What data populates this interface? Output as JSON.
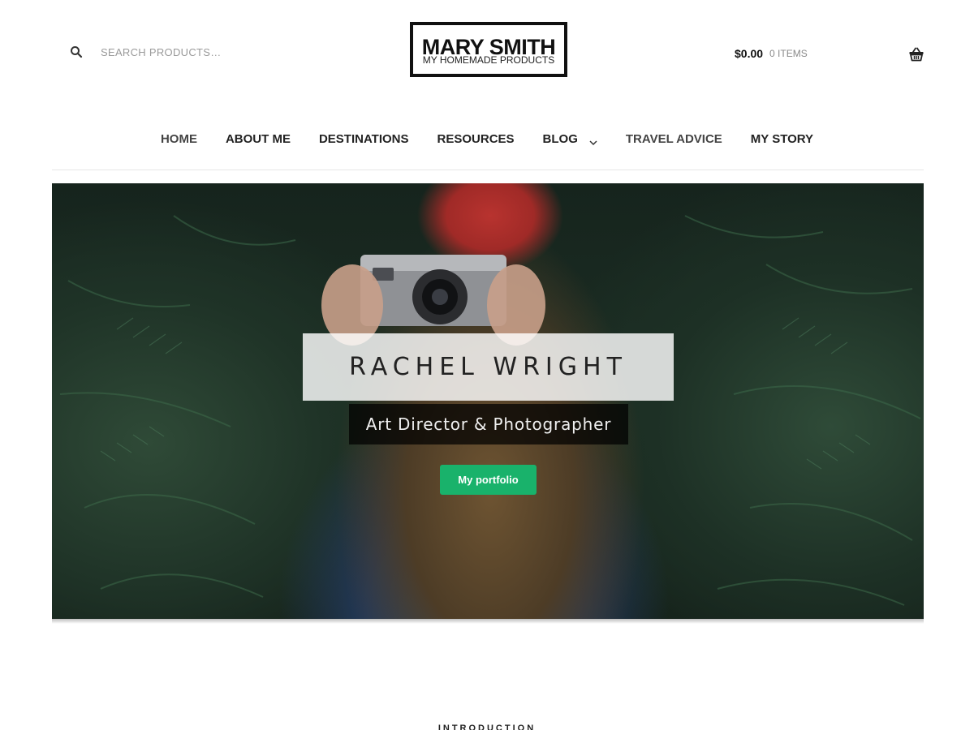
{
  "search": {
    "placeholder": "SEARCH PRODUCTS…"
  },
  "logo": {
    "title": "MARY SMITH",
    "subtitle": "MY HOMEMADE PRODUCTS"
  },
  "cart": {
    "amount": "$0.00",
    "count": "0 ITEMS"
  },
  "nav": {
    "items": [
      {
        "label": "HOME"
      },
      {
        "label": "ABOUT ME"
      },
      {
        "label": "DESTINATIONS"
      },
      {
        "label": "RESOURCES"
      },
      {
        "label": "BLOG"
      },
      {
        "label": "TRAVEL ADVICE"
      },
      {
        "label": "MY STORY"
      }
    ]
  },
  "hero": {
    "name": "RACHEL WRIGHT",
    "role": "Art Director & Photographer",
    "button_label": "My portfolio"
  },
  "intro": {
    "label": "INTRODUCTION"
  },
  "icons": {
    "search": "search-icon",
    "cart": "basket-icon",
    "dropdown": "chevron-down-icon"
  },
  "colors": {
    "accent": "#19b26b",
    "text": "#222222",
    "muted": "#9a9a9a"
  }
}
